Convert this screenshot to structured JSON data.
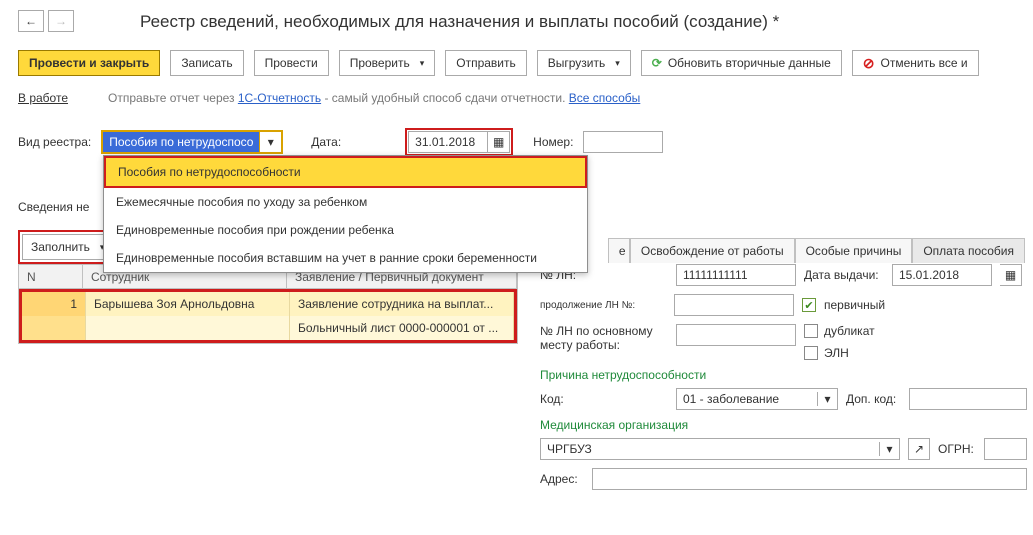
{
  "page_title": "Реестр сведений, необходимых для назначения и выплаты пособий (создание) *",
  "toolbar": {
    "provesti_close": "Провести и закрыть",
    "zapisat": "Записать",
    "provesti": "Провести",
    "proverit": "Проверить",
    "otpravit": "Отправить",
    "vygruzit": "Выгрузить",
    "refresh": "Обновить вторичные данные",
    "cancel_all": "Отменить все и"
  },
  "status": {
    "in_work": "В работе",
    "hint_prefix": "Отправьте отчет через ",
    "hint_link": "1С-Отчетность",
    "hint_suffix": " - самый удобный способ сдачи отчетности. ",
    "all_methods": "Все способы"
  },
  "params": {
    "vid_label": "Вид реестра:",
    "vid_value": "Пособия по нетрудоспосо",
    "date_label": "Дата:",
    "date_value": "31.01.2018",
    "nomer_label": "Номер:",
    "nomer_value": ""
  },
  "dropdown": [
    "Пособия по нетрудоспособности",
    "Ежемесячные пособия по уходу за ребенком",
    "Единовременные пособия при рождении ребенка",
    "Единовременные пособия вставшим на учет в ранние сроки беременности"
  ],
  "left_tab": "Сведения не",
  "fill_btn": "Заполнить",
  "grid": {
    "col_n": "N",
    "col_emp": "Сотрудник",
    "col_doc": "Заявление / Первичный документ",
    "rows": [
      {
        "n": "1",
        "emp": "Барышева Зоя Арнольдовна",
        "doc": "Заявление сотрудника на выплат..."
      },
      {
        "n": "",
        "emp": "",
        "doc": "Больничный лист 0000-000001 от ..."
      }
    ]
  },
  "right_tabs": [
    "е",
    "Освобождение от работы",
    "Особые причины",
    "Оплата пособия"
  ],
  "right_form": {
    "ln_label": "№ ЛН:",
    "ln_value": "11111111111",
    "date_issue_label": "Дата выдачи:",
    "date_issue_value": "15.01.2018",
    "continuation_label": "продолжение ЛН №:",
    "continuation_value": "",
    "primary_label": "первичный",
    "ln_main_label1": "№ ЛН по основному",
    "ln_main_label2": "месту работы:",
    "ln_main_value": "",
    "duplicate_label": "дубликат",
    "eln_label": "ЭЛН",
    "reason_header": "Причина нетрудоспособности",
    "code_label": "Код:",
    "code_value": "01 - заболевание",
    "dop_code_label": "Доп. код:",
    "dop_code_value": "",
    "med_header": "Медицинская организация",
    "med_value": "ЧРГБУЗ",
    "ogrn_label": "ОГРН:",
    "ogrn_value": "",
    "addr_label": "Адрес:",
    "addr_value": ""
  }
}
